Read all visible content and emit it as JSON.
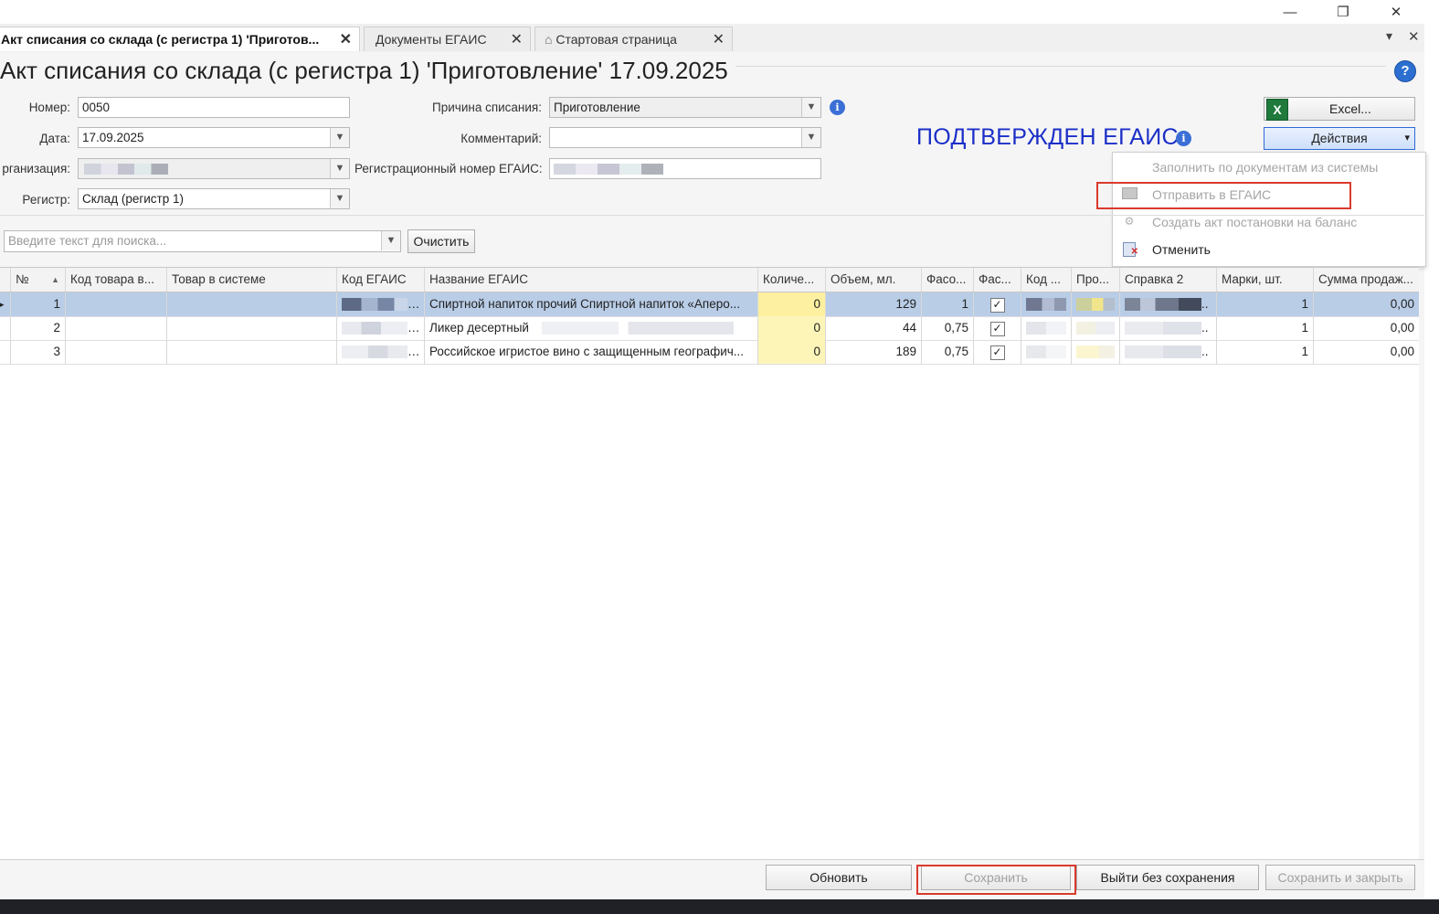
{
  "window": {
    "minimize": "—",
    "maximize": "❐",
    "close": "✕"
  },
  "tabs": [
    {
      "label": "Акт списания со склада (с регистра 1) 'Приготов...",
      "close": "✕"
    },
    {
      "label": "Документы ЕГАИС",
      "close": "✕"
    },
    {
      "icon": "⌂",
      "label": "Стартовая страница",
      "close": "✕"
    }
  ],
  "tabstrip_controls": {
    "dropdown": "▾",
    "close": "✕"
  },
  "doc": {
    "title": "Акт списания со склада (с регистра 1) 'Приготовление' 17.09.2025",
    "help": "?"
  },
  "form": {
    "number_label": "Номер:",
    "number_value": "0050",
    "date_label": "Дата:",
    "date_value": "17.09.2025",
    "org_label": "рганизация:",
    "register_label": "Регистр:",
    "register_value": "Склад (регистр 1)",
    "reason_label": "Причина списания:",
    "reason_value": "Приготовление",
    "comment_label": "Комментарий:",
    "comment_value": "",
    "egais_reg_label": "Регистрационный номер ЕГАИС:",
    "info": "i"
  },
  "status": {
    "text": "ПОДТВЕРЖДЕН ЕГАИС",
    "color": "#1b2fc8"
  },
  "buttons": {
    "excel_icon": "X",
    "excel": "Excel...",
    "actions": "Действия",
    "actions_arrow": "▾",
    "clear": "Очистить"
  },
  "menu": [
    {
      "label": "Заполнить по документам из системы",
      "enabled": false
    },
    {
      "label": "Отправить в ЕГАИС",
      "enabled": false
    },
    {
      "label": "Создать акт постановки на баланс",
      "enabled": false
    },
    {
      "label": "Отменить",
      "enabled": true
    }
  ],
  "search": {
    "placeholder": "Введите текст для поиска..."
  },
  "grid": {
    "columns": [
      "№",
      "Код товара в...",
      "Товар в системе",
      "Код ЕГАИС",
      "Название ЕГАИС",
      "Количе...",
      "Объем, мл.",
      "Фасо...",
      "Фас...",
      "Код ...",
      "Про...",
      "Справка 2",
      "Марки, шт.",
      "Сумма продаж..."
    ],
    "sort_indicator": "▲",
    "rows": [
      {
        "n": "1",
        "name": "Спиртной напиток прочий Спиртной напиток «Аперо...",
        "qty": "0",
        "volume": "129",
        "pack": "1",
        "checked": "✓",
        "marks": "1",
        "sum": "0,00"
      },
      {
        "n": "2",
        "name": "Ликер десертный",
        "qty": "0",
        "volume": "44",
        "pack": "0,75",
        "checked": "✓",
        "marks": "1",
        "sum": "0,00"
      },
      {
        "n": "3",
        "name": "Российское игристое вино с защищенным географич...",
        "qty": "0",
        "volume": "189",
        "pack": "0,75",
        "checked": "✓",
        "marks": "1",
        "sum": "0,00"
      }
    ]
  },
  "footer": {
    "refresh": "Обновить",
    "save": "Сохранить",
    "exit_no_save": "Выйти без сохранения",
    "save_close": "Сохранить и закрыть"
  },
  "highlight_color": "#d93a2d"
}
